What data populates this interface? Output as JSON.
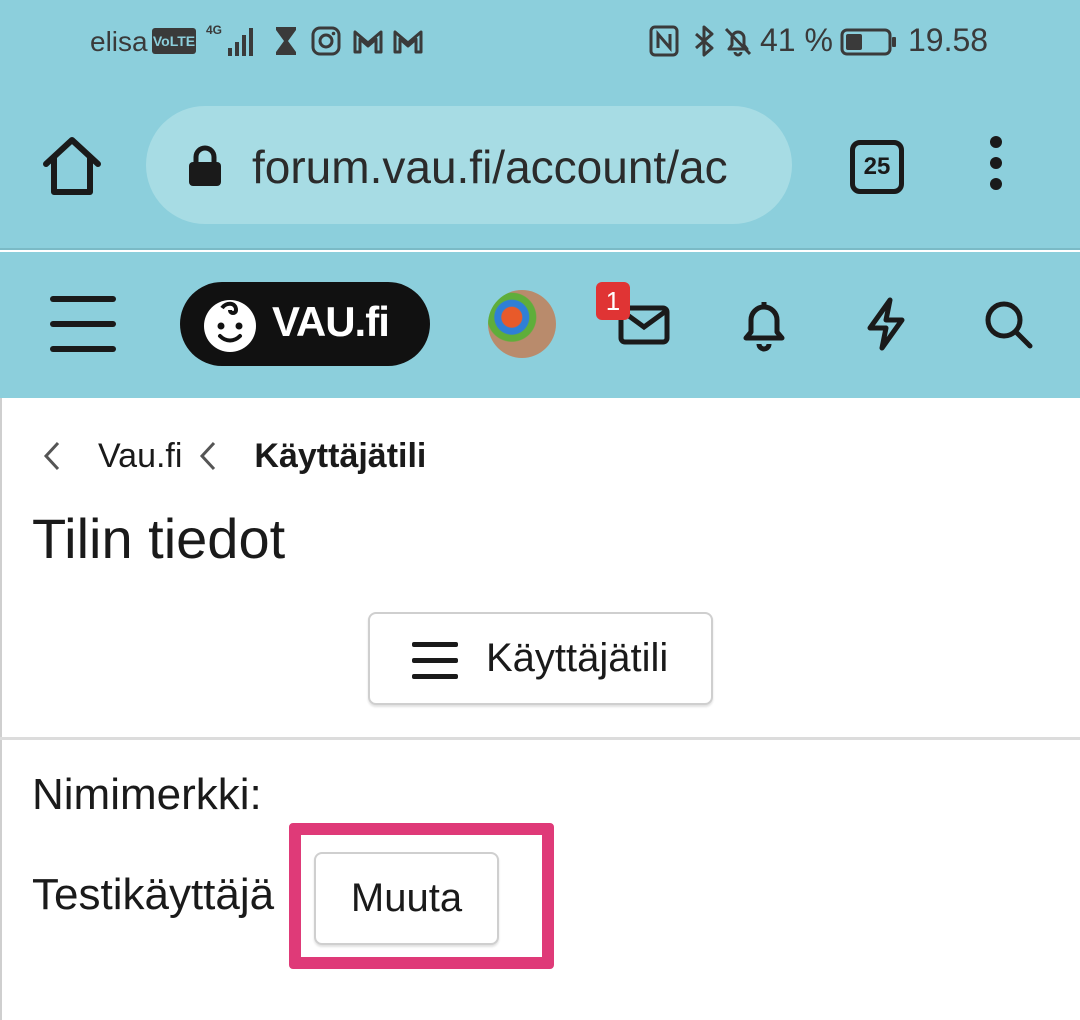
{
  "status_bar": {
    "carrier": "elisa",
    "volte_label": "VoLTE",
    "network": "4G",
    "battery_percent": "41 %",
    "battery_level": 0.41,
    "time": "19.58",
    "icons": [
      "hourglass-icon",
      "instagram-icon",
      "gmail-icon",
      "gmail-icon",
      "nfc-icon",
      "bluetooth-icon",
      "silent-icon",
      "battery-icon"
    ]
  },
  "browser": {
    "url": "forum.vau.fi/account/ac",
    "tab_count": "25"
  },
  "site_header": {
    "logo_text": "VAU.fi",
    "unread_messages": "1"
  },
  "breadcrumb": {
    "parent": "Vau.fi",
    "current": "Käyttäjätili"
  },
  "page": {
    "title": "Tilin tiedot",
    "account_menu_label": "Käyttäjätili",
    "field_label": "Nimimerkki:",
    "field_value": "Testikäyttäjä",
    "change_button": "Muuta"
  },
  "colors": {
    "header_bg": "#8ccfdc",
    "url_pill_bg": "#a7dce4",
    "highlight": "#df3a78",
    "badge": "#e03434"
  }
}
